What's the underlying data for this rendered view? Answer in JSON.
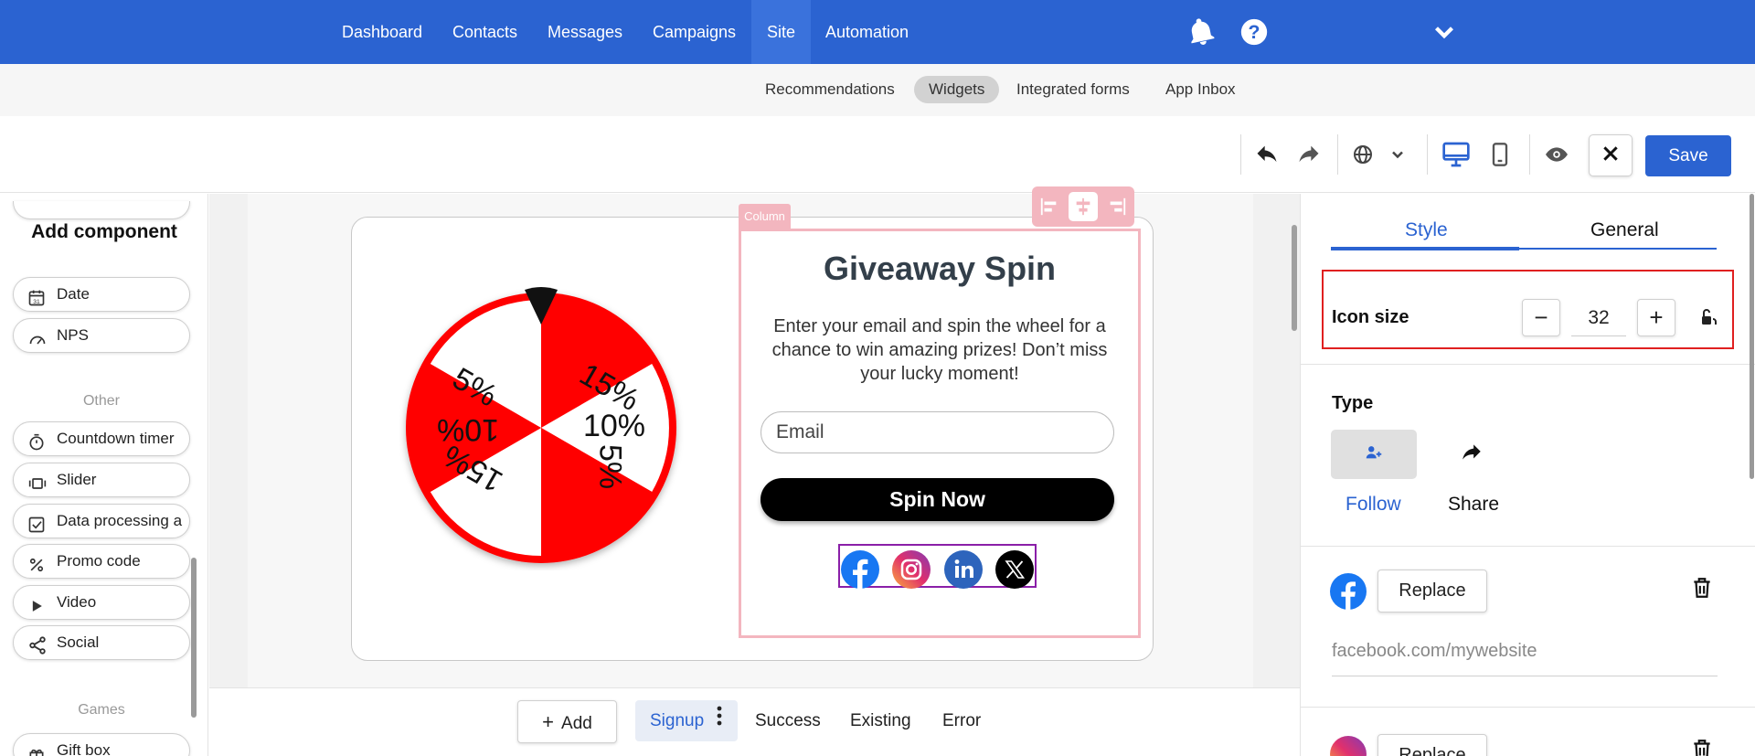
{
  "topnav": {
    "items": [
      "Dashboard",
      "Contacts",
      "Messages",
      "Campaigns",
      "Site",
      "Automation"
    ],
    "active": "Site",
    "icons": [
      "bell-icon",
      "help-icon",
      "chevron-down-icon"
    ]
  },
  "subnav": {
    "items": [
      "Recommendations",
      "Widgets",
      "Integrated forms",
      "App Inbox"
    ],
    "active": "Widgets"
  },
  "toolbar": {
    "save_label": "Save",
    "icons": [
      "undo-icon",
      "redo-icon",
      "globe-icon",
      "chevron-down-icon",
      "desktop-icon",
      "mobile-icon",
      "eye-icon",
      "close-icon"
    ]
  },
  "left_panel": {
    "title": "Add component",
    "items_top": [
      {
        "label": "Date",
        "icon": "calendar-icon"
      },
      {
        "label": "NPS",
        "icon": "gauge-icon"
      }
    ],
    "group_other": "Other",
    "items_other": [
      {
        "label": "Countdown timer",
        "icon": "timer-icon"
      },
      {
        "label": "Slider",
        "icon": "slider-icon"
      },
      {
        "label": "Data processing a",
        "icon": "checkbox-icon"
      },
      {
        "label": "Promo code",
        "icon": "percent-icon"
      },
      {
        "label": "Video",
        "icon": "play-icon"
      },
      {
        "label": "Social",
        "icon": "share-icon"
      }
    ],
    "group_games": "Games",
    "items_games": [
      {
        "label": "Gift box",
        "icon": "gift-icon"
      }
    ]
  },
  "canvas": {
    "column_tag": "Column",
    "wheel_segments": [
      "5%",
      "10%",
      "15%",
      "5%",
      "10%",
      "15%"
    ],
    "popup_title": "Giveaway Spin",
    "popup_desc": "Enter your email and spin the wheel for a chance to win amazing prizes! Don’t miss your lucky moment!",
    "email_placeholder": "Email",
    "spin_label": "Spin Now",
    "social_icons": [
      "facebook-icon",
      "instagram-icon",
      "linkedin-icon",
      "x-icon"
    ]
  },
  "bottom": {
    "add_label": "Add",
    "tabs": [
      "Signup",
      "Success",
      "Existing",
      "Error"
    ],
    "active": "Signup"
  },
  "right_panel": {
    "tabs": [
      "Style",
      "General"
    ],
    "active_tab": "Style",
    "icon_size_label": "Icon size",
    "icon_size_value": "32",
    "minus": "−",
    "plus": "+",
    "type_label": "Type",
    "type_options": [
      "Follow",
      "Share"
    ],
    "type_active": "Follow",
    "replace_label": "Replace",
    "facebook_url": "facebook.com/mywebsite"
  },
  "colors": {
    "brand": "#2b63d1",
    "wheel_red": "#ff0000",
    "highlight_red": "#e02020",
    "column_pink": "#f3b6bf"
  }
}
